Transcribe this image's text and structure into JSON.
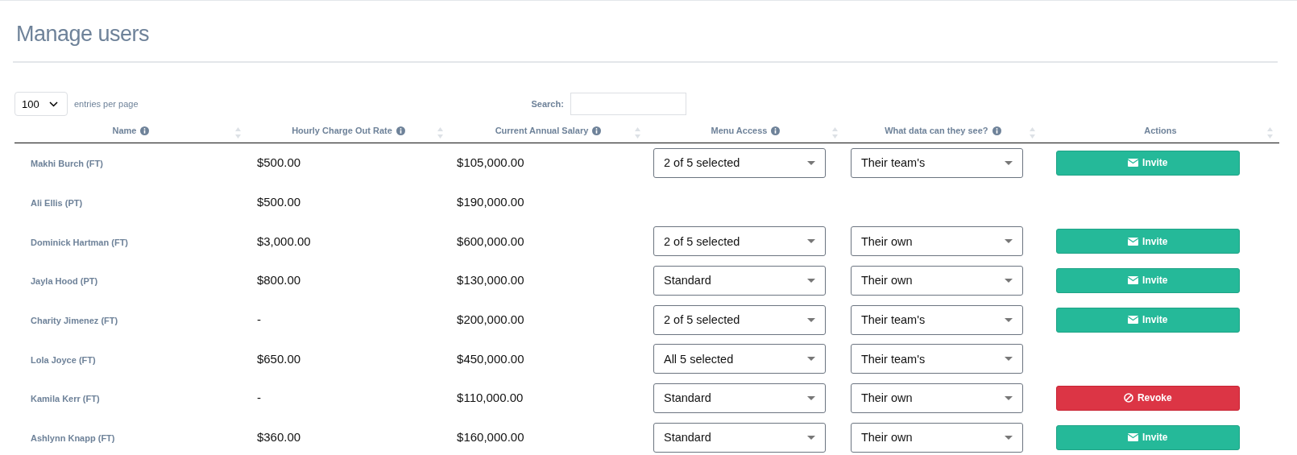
{
  "title": "Manage users",
  "page_size": {
    "value": "100",
    "label": "entries per page"
  },
  "search": {
    "label": "Search:"
  },
  "table": {
    "columns": [
      {
        "label": "Name",
        "info": true
      },
      {
        "label": "Hourly Charge Out Rate",
        "info": true
      },
      {
        "label": "Current Annual Salary",
        "info": true
      },
      {
        "label": "Menu Access",
        "info": true
      },
      {
        "label": "What data can they see?",
        "info": true
      },
      {
        "label": "Actions",
        "info": false
      }
    ],
    "rows": [
      {
        "name": "Makhi Burch (FT)",
        "rate": "$500.00",
        "salary": "$105,000.00",
        "menu_access": "2 of 5 selected",
        "data_scope": "Their team's",
        "action": {
          "kind": "invite",
          "label": "Invite"
        }
      },
      {
        "name": "Ali Ellis (PT)",
        "rate": "$500.00",
        "salary": "$190,000.00"
      },
      {
        "name": "Dominick Hartman (FT)",
        "rate": "$3,000.00",
        "salary": "$600,000.00",
        "menu_access": "2 of 5 selected",
        "data_scope": "Their own",
        "action": {
          "kind": "invite",
          "label": "Invite"
        }
      },
      {
        "name": "Jayla Hood (PT)",
        "rate": "$800.00",
        "salary": "$130,000.00",
        "menu_access": "Standard",
        "data_scope": "Their own",
        "action": {
          "kind": "invite",
          "label": "Invite"
        }
      },
      {
        "name": "Charity Jimenez (FT)",
        "rate": "-",
        "salary": "$200,000.00",
        "menu_access": "2 of 5 selected",
        "data_scope": "Their team's",
        "action": {
          "kind": "invite",
          "label": "Invite"
        }
      },
      {
        "name": "Lola Joyce (FT)",
        "rate": "$650.00",
        "salary": "$450,000.00",
        "menu_access": "All 5 selected",
        "data_scope": "Their team's"
      },
      {
        "name": "Kamila Kerr (FT)",
        "rate": "-",
        "salary": "$110,000.00",
        "menu_access": "Standard",
        "data_scope": "Their own",
        "action": {
          "kind": "revoke",
          "label": "Revoke"
        }
      },
      {
        "name": "Ashlynn Knapp (FT)",
        "rate": "$360.00",
        "salary": "$160,000.00",
        "menu_access": "Standard",
        "data_scope": "Their own",
        "action": {
          "kind": "invite",
          "label": "Invite"
        }
      }
    ]
  }
}
